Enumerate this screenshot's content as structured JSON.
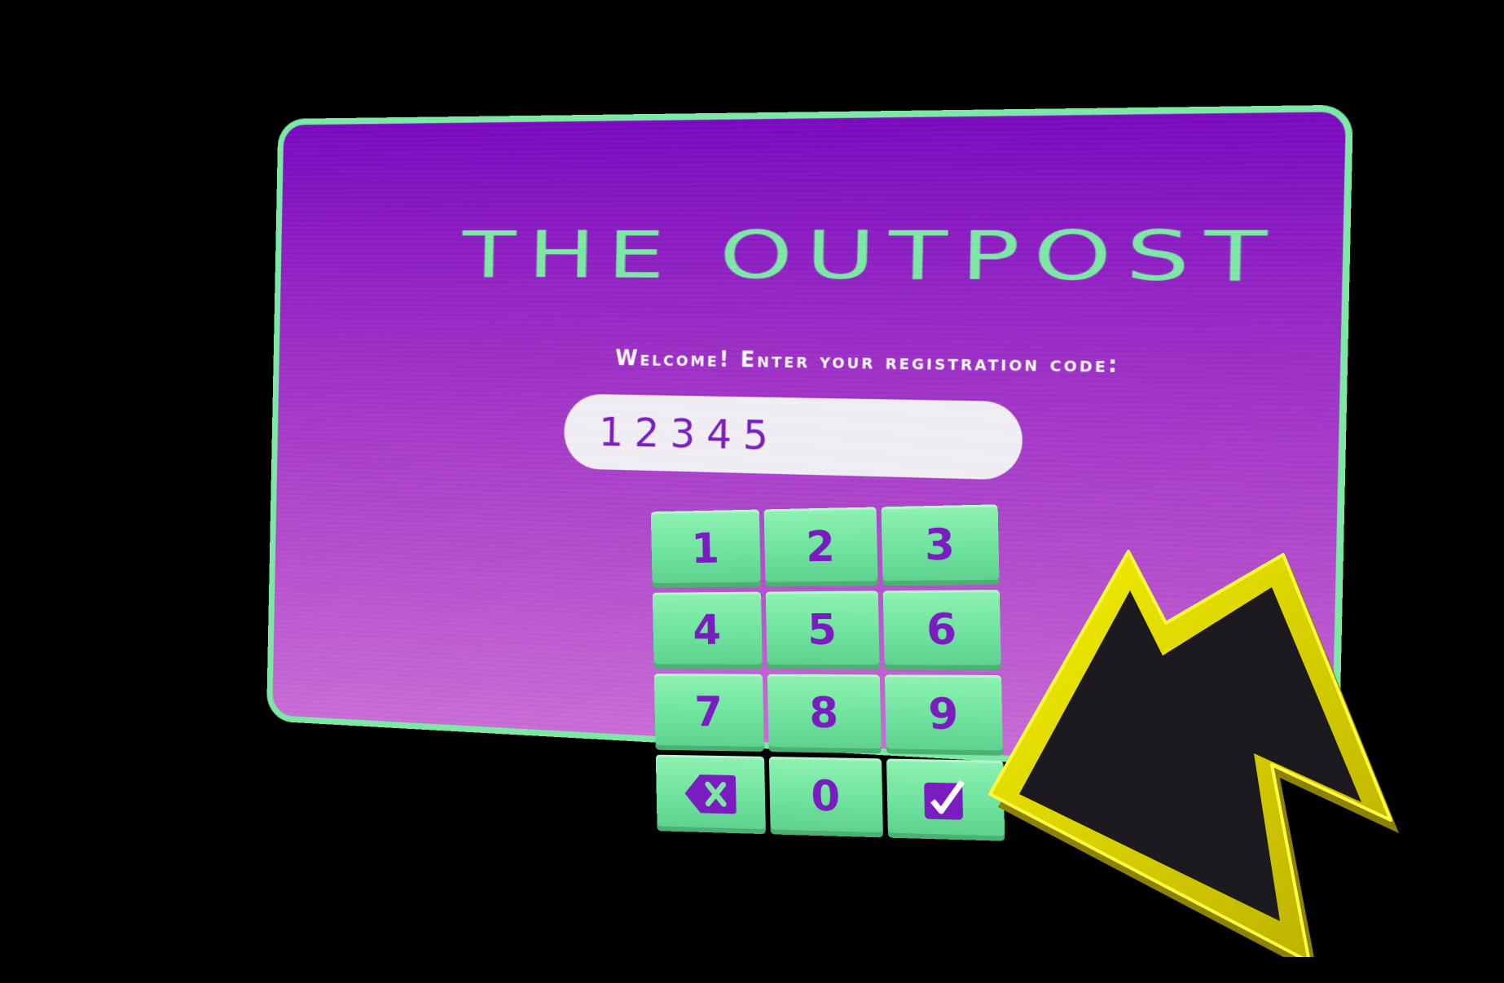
{
  "title": "THE OUTPOST",
  "prompt": "Welcome! Enter your registration code:",
  "code_input": {
    "value": "12345"
  },
  "keypad": {
    "keys": [
      {
        "label": "1"
      },
      {
        "label": "2"
      },
      {
        "label": "3"
      },
      {
        "label": "4"
      },
      {
        "label": "5"
      },
      {
        "label": "6"
      },
      {
        "label": "7"
      },
      {
        "label": "8"
      },
      {
        "label": "9"
      },
      {
        "label": "",
        "icon": "backspace-icon"
      },
      {
        "label": "0"
      },
      {
        "label": "",
        "icon": "checkmark-icon"
      }
    ]
  },
  "cursor": {
    "icon": "pointer-arrow-icon"
  },
  "colors": {
    "panel_border": "#7de8a6",
    "panel_top": "#7a0ac0",
    "panel_bottom": "#c96cd6",
    "key_face": "#6ee39d",
    "key_text": "#7a1cc0",
    "cursor_fill": "#1c1a1e",
    "cursor_outline": "#f2ea00"
  }
}
